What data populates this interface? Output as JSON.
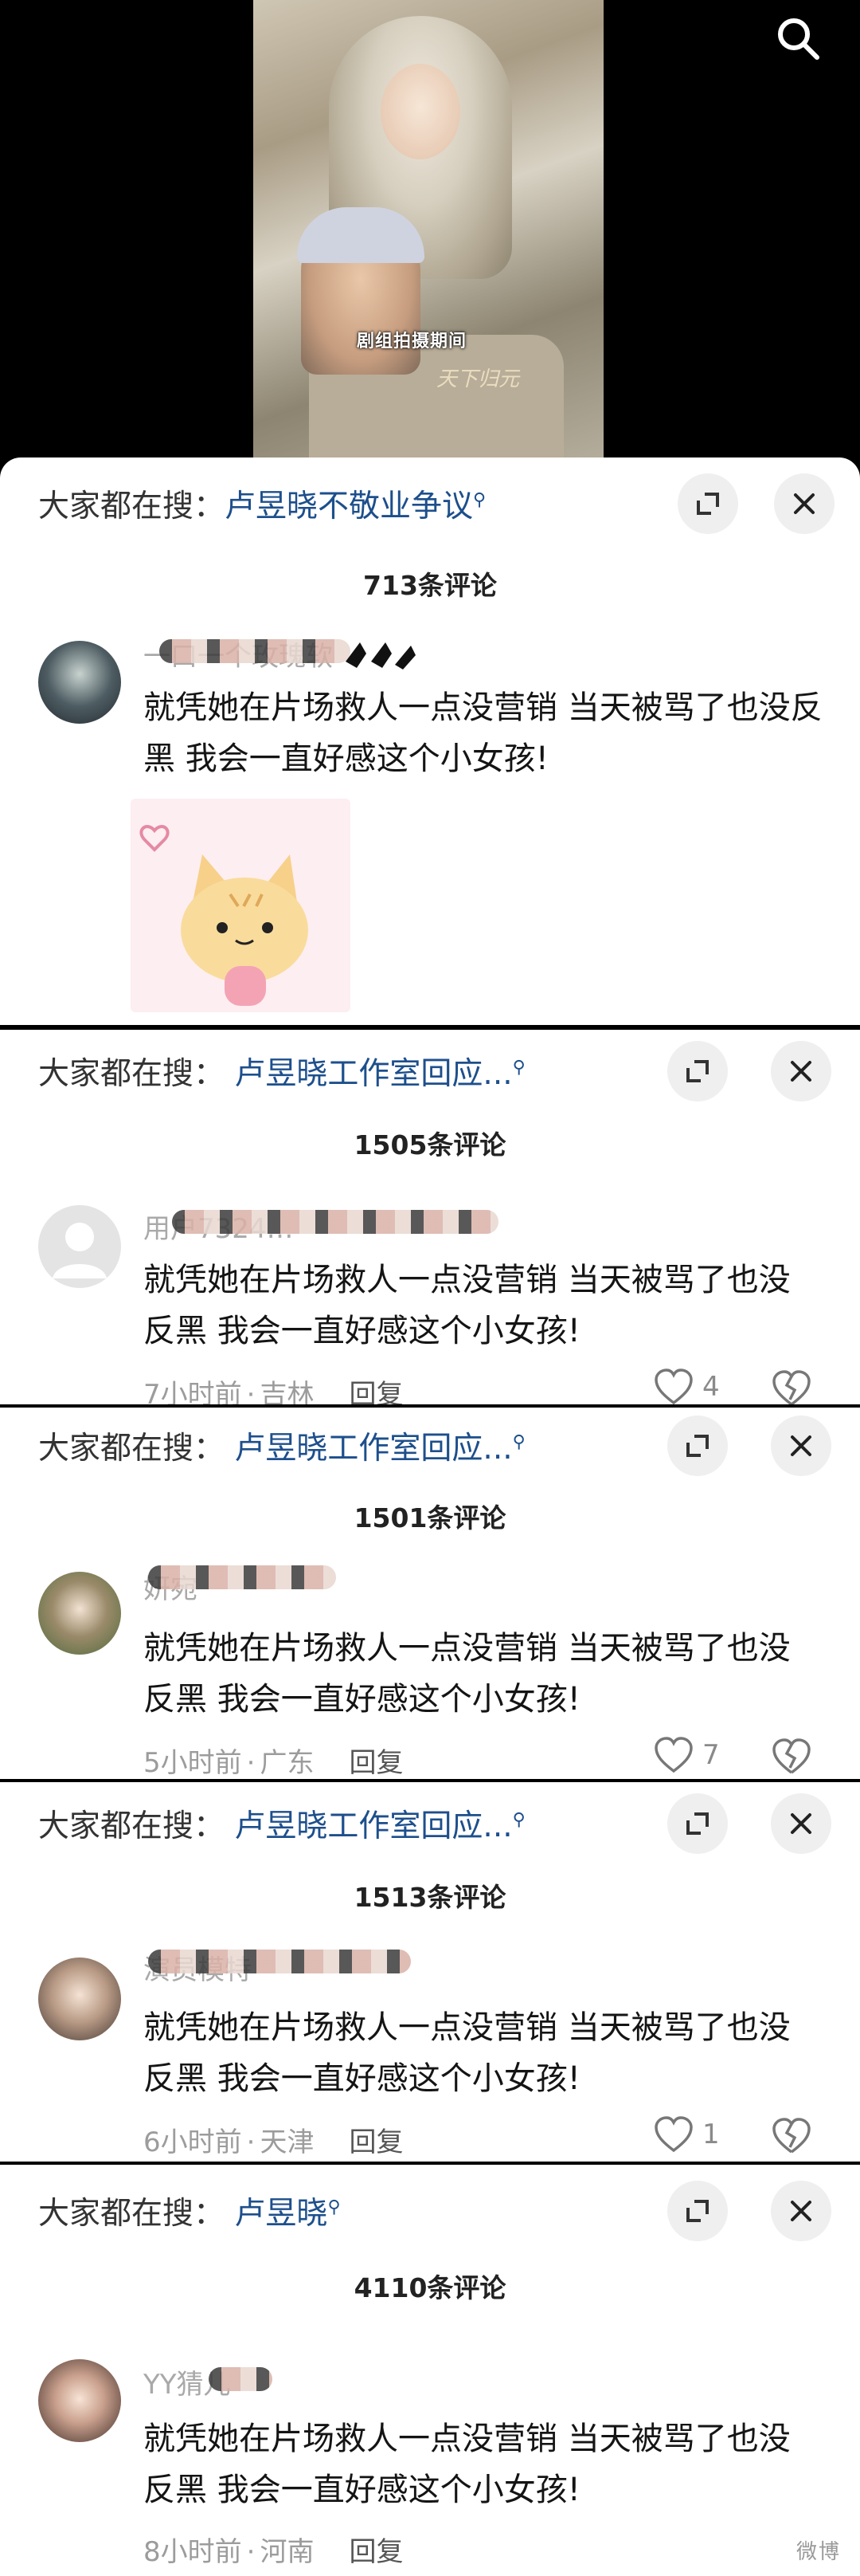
{
  "video": {
    "caption": "剧组拍摄期间",
    "watermark": "天下归元"
  },
  "panels": [
    {
      "search_prefix": "大家都在搜：",
      "search_term": "卢昱晓不敬业争议",
      "count": "713条评论",
      "comment": {
        "username": "一口一个玫瑰软",
        "text": "就凭她在片场救人一点没营销 当天被骂了也没反黑   我会一直好感这个小女孩!"
      }
    },
    {
      "search_prefix": "大家都在搜：",
      "search_term": "卢昱晓工作室回应...",
      "count": "1505条评论",
      "comment": {
        "username": "用户7324…",
        "text": "就凭她在片场救人一点没营销 当天被骂了也没反黑   我会一直好感这个小女孩!",
        "time": "7小时前",
        "location": "吉林",
        "reply": "回复",
        "likes": "4"
      }
    },
    {
      "search_prefix": "大家都在搜：",
      "search_term": "卢昱晓工作室回应...",
      "count": "1501条评论",
      "comment": {
        "username": "妍宛",
        "text": "就凭她在片场救人一点没营销 当天被骂了也没反黑   我会一直好感这个小女孩!",
        "time": "5小时前",
        "location": "广东",
        "reply": "回复",
        "likes": "7"
      }
    },
    {
      "search_prefix": "大家都在搜：",
      "search_term": "卢昱晓工作室回应...",
      "count": "1513条评论",
      "comment": {
        "username": "演员模特",
        "text": "就凭她在片场救人一点没营销 当天被骂了也没反黑   我会一直好感这个小女孩!",
        "time": "6小时前",
        "location": "天津",
        "reply": "回复",
        "likes": "1"
      }
    },
    {
      "search_prefix": "大家都在搜：",
      "search_term": "卢昱晓",
      "count": "4110条评论",
      "comment": {
        "username": "YY猜儿",
        "text": "就凭她在片场救人一点没营销 当天被骂了也没反黑   我会一直好感这个小女孩!",
        "time": "8小时前",
        "location": "河南",
        "reply": "回复"
      }
    }
  ],
  "footer_watermark": "微博"
}
